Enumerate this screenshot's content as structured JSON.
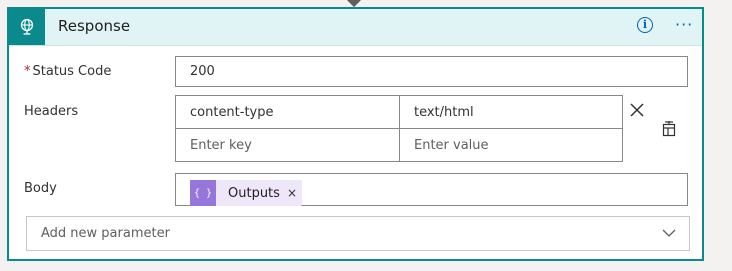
{
  "card": {
    "title": "Response",
    "info_icon": "info-icon",
    "more_icon": "more-options-icon",
    "action_icon": "globe-icon"
  },
  "status_code": {
    "label": "Status Code",
    "required_mark": "*",
    "value": "200"
  },
  "headers": {
    "label": "Headers",
    "rows": [
      {
        "key": "content-type",
        "value": "text/html"
      }
    ],
    "new_row": {
      "key_placeholder": "Enter key",
      "value_placeholder": "Enter value"
    },
    "delete_icon": "close-icon",
    "switch_icon": "switch-to-text-mode-icon"
  },
  "body": {
    "label": "Body",
    "token": {
      "icon_text": "{ }",
      "label": "Outputs",
      "remove": "×"
    }
  },
  "add_parameter": {
    "placeholder": "Add new parameter",
    "chevron_icon": "chevron-down-icon"
  },
  "colors": {
    "accent": "#0a8a8c",
    "header_bg": "#e0f3f5",
    "token_bg": "#ede7f9",
    "token_icon_bg": "#9676d8",
    "link": "#0063b1"
  }
}
